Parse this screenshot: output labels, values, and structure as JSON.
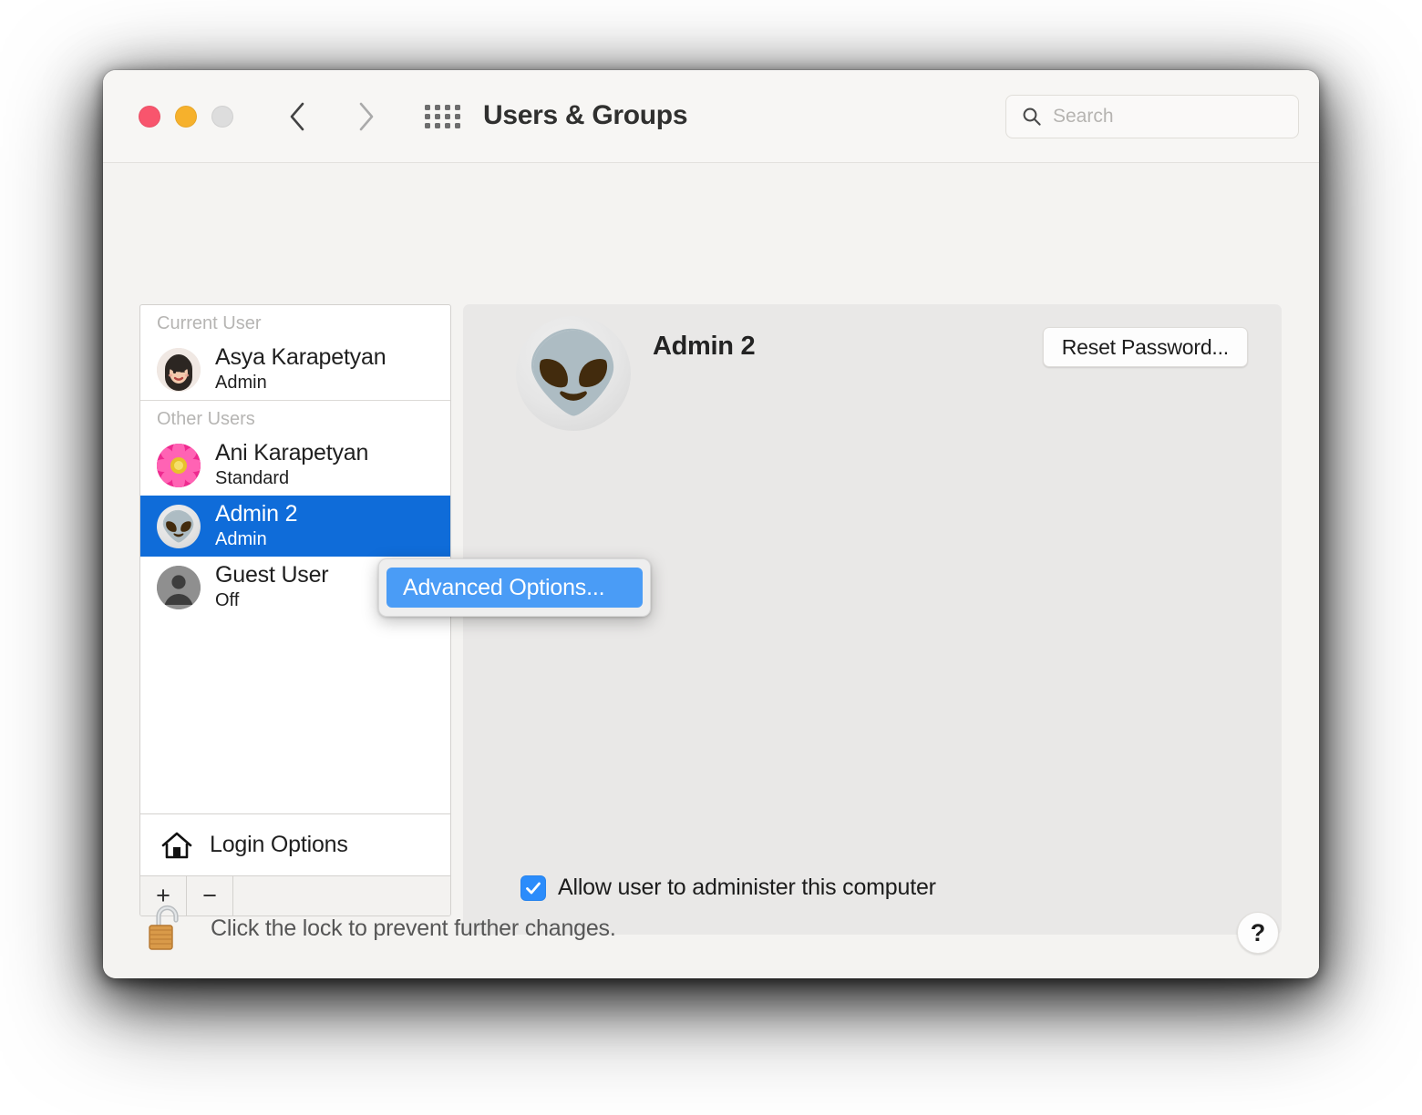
{
  "window": {
    "title": "Users & Groups",
    "traffic_lights": {
      "close": "close-button",
      "minimize": "minimize-button",
      "zoom": "zoom-button"
    },
    "nav": {
      "back": "back-arrow-icon",
      "forward": "forward-arrow-icon",
      "show_all": "grid-icon"
    }
  },
  "search": {
    "placeholder": "Search",
    "value": "",
    "icon": "search-icon"
  },
  "sidebar": {
    "sections": [
      {
        "label": "Current User",
        "users": [
          {
            "name": "Asya Karapetyan",
            "role": "Admin",
            "avatar": "memoji-avatar",
            "glyph": "",
            "selected": false
          }
        ]
      },
      {
        "label": "Other Users",
        "users": [
          {
            "name": "Ani Karapetyan",
            "role": "Standard",
            "avatar": "flower-avatar",
            "glyph": "",
            "selected": false
          },
          {
            "name": "Admin 2",
            "role": "Admin",
            "avatar": "alien-avatar",
            "glyph": "👽",
            "selected": true
          },
          {
            "name": "Guest User",
            "role": "Off",
            "avatar": "person-avatar",
            "glyph": "",
            "selected": false
          }
        ]
      }
    ],
    "login_options": {
      "label": "Login Options",
      "icon": "home-icon"
    },
    "toolbar": {
      "add_label": "+",
      "remove_label": "−"
    }
  },
  "panel": {
    "username": "Admin 2",
    "avatar_glyph": "👽",
    "reset_password_label": "Reset Password...",
    "administer_checkbox": {
      "label": "Allow user to administer this computer",
      "checked": true,
      "check_glyph": "✓"
    }
  },
  "context_menu": {
    "items": [
      {
        "label": "Advanced Options...",
        "highlighted": true
      }
    ]
  },
  "footer": {
    "lock_icon": "unlocked-padlock-icon",
    "message": "Click the lock to prevent further changes.",
    "help_label": "?"
  },
  "colors": {
    "selection_blue": "#0f6cd9",
    "menu_highlight_blue": "#4a9cf6",
    "checkbox_blue": "#2b8cfb",
    "close_red": "#f8556d",
    "minimize_yellow": "#f6b12c",
    "zoom_gray": "#dddddd",
    "panel_gray": "#e9e8e7",
    "window_bg": "#f4f3f1"
  }
}
